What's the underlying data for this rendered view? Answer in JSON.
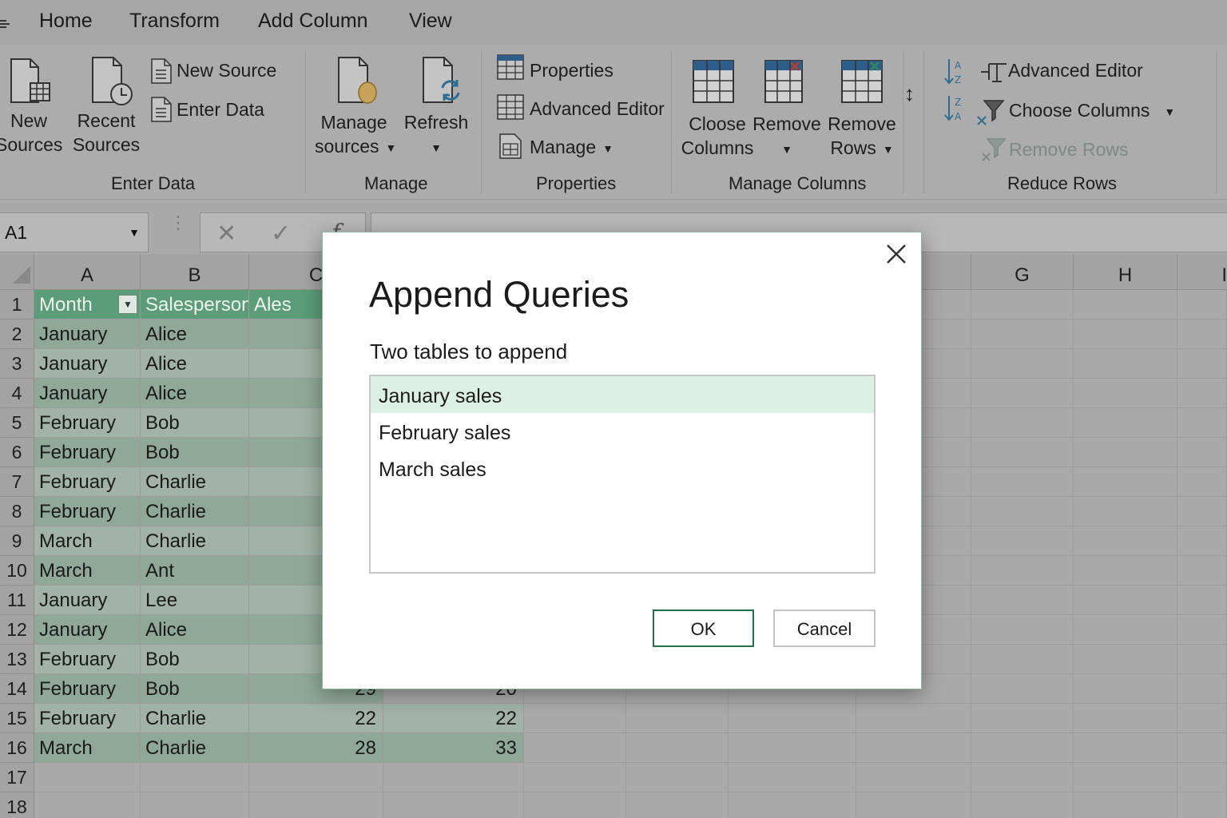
{
  "tabs": [
    "Home",
    "Transform",
    "Add Column",
    "View"
  ],
  "ribbon": {
    "enter_data": {
      "new_sources": [
        "New",
        "Sources"
      ],
      "recent_sources": [
        "Recent",
        "Sources"
      ],
      "new_source": "New Source",
      "enter_data": "Enter Data",
      "group_label": "Enter Data"
    },
    "manage": {
      "manage_sources": [
        "Manage",
        "sources"
      ],
      "refresh": "Refresh",
      "group_label": "Manage"
    },
    "properties": {
      "properties": "Properties",
      "advanced_editor": "Advanced Editor",
      "manage": "Manage",
      "group_label": "Properties"
    },
    "manage_columns": {
      "choose_columns": [
        "Cloose",
        "Columns"
      ],
      "remove": "Remove",
      "remove_rows": [
        "Remove",
        "Rows"
      ],
      "group_label": "Manage Columns"
    },
    "reduce_rows": {
      "advanced_editor": "Advanced Editor",
      "choose_columns": "Choose Columns",
      "remove_rows": "Remove Rows",
      "group_label": "Reduce Rows"
    }
  },
  "formula_bar": {
    "name_box": "A1",
    "fx": "f"
  },
  "grid": {
    "columns": [
      "A",
      "B",
      "C",
      "G",
      "H",
      "I"
    ],
    "rows": [
      "1",
      "2",
      "3",
      "4",
      "5",
      "6",
      "7",
      "8",
      "9",
      "10",
      "11",
      "12",
      "13",
      "14",
      "15",
      "16",
      "17",
      "18"
    ],
    "header": {
      "month": "Month",
      "salesperson": "Salesperson",
      "c": "Ales"
    },
    "data": [
      {
        "month": "January",
        "person": "Alice"
      },
      {
        "month": "January",
        "person": "Alice"
      },
      {
        "month": "January",
        "person": "Alice"
      },
      {
        "month": "February",
        "person": "Bob"
      },
      {
        "month": "February",
        "person": "Bob"
      },
      {
        "month": "February",
        "person": "Charlie"
      },
      {
        "month": "February",
        "person": "Charlie"
      },
      {
        "month": "March",
        "person": "Charlie"
      },
      {
        "month": "March",
        "person": "Ant"
      },
      {
        "month": "January",
        "person": "Lee"
      },
      {
        "month": "January",
        "person": "Alice"
      },
      {
        "month": "February",
        "person": "Bob"
      },
      {
        "month": "February",
        "person": "Bob",
        "c": "29",
        "d": "20"
      },
      {
        "month": "February",
        "person": "Charlie",
        "c": "22",
        "d": "22"
      },
      {
        "month": "March",
        "person": "Charlie",
        "c": "28",
        "d": "33"
      }
    ]
  },
  "dialog": {
    "title": "Append Queries",
    "label": "Two tables to append",
    "items": [
      "January sales",
      "February sales",
      "March sales"
    ],
    "selected_index": 0,
    "ok": "OK",
    "cancel": "Cancel"
  },
  "colors": {
    "accent": "#217346",
    "table_header": "#5b9d78",
    "selected_item": "#ddf0e5"
  }
}
